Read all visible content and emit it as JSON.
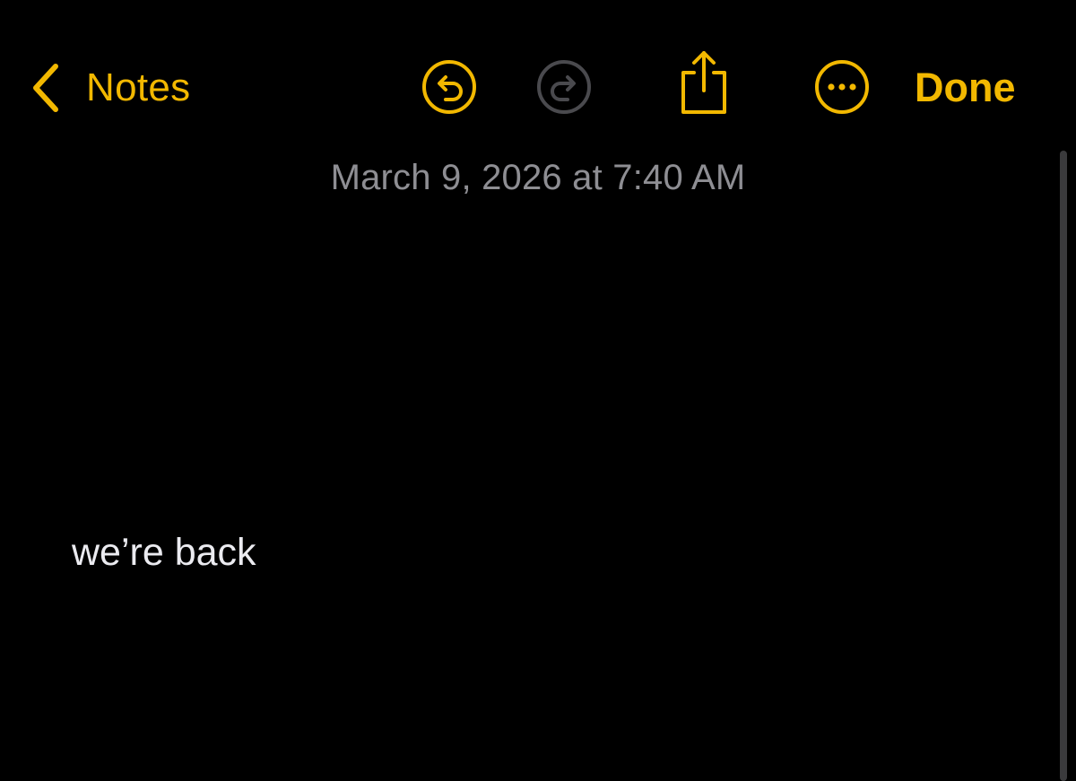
{
  "header": {
    "back_label": "Notes",
    "done_label": "Done"
  },
  "toolbar": {
    "icons": [
      "chevron-left-icon",
      "undo-icon",
      "redo-icon",
      "share-icon",
      "more-icon"
    ]
  },
  "note": {
    "date": "March 9, 2026 at 7:40 AM",
    "body": "we’re back"
  },
  "colors": {
    "accent": "#F2B800",
    "disabled": "#4A4A4E",
    "date_text": "#8E8E93",
    "body_text": "#EBEBF0",
    "background": "#000000",
    "scrollbar": "#3A3A3C"
  }
}
